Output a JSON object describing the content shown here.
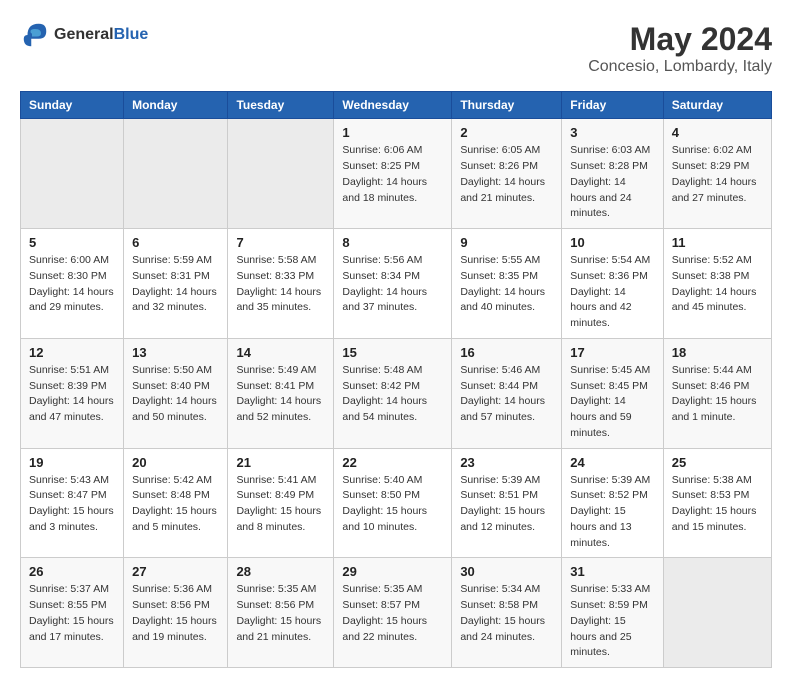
{
  "logo": {
    "line1": "General",
    "line2": "Blue"
  },
  "title": "May 2024",
  "subtitle": "Concesio, Lombardy, Italy",
  "header_days": [
    "Sunday",
    "Monday",
    "Tuesday",
    "Wednesday",
    "Thursday",
    "Friday",
    "Saturday"
  ],
  "weeks": [
    [
      {
        "day": "",
        "sunrise": "",
        "sunset": "",
        "daylight": ""
      },
      {
        "day": "",
        "sunrise": "",
        "sunset": "",
        "daylight": ""
      },
      {
        "day": "",
        "sunrise": "",
        "sunset": "",
        "daylight": ""
      },
      {
        "day": "1",
        "sunrise": "Sunrise: 6:06 AM",
        "sunset": "Sunset: 8:25 PM",
        "daylight": "Daylight: 14 hours and 18 minutes."
      },
      {
        "day": "2",
        "sunrise": "Sunrise: 6:05 AM",
        "sunset": "Sunset: 8:26 PM",
        "daylight": "Daylight: 14 hours and 21 minutes."
      },
      {
        "day": "3",
        "sunrise": "Sunrise: 6:03 AM",
        "sunset": "Sunset: 8:28 PM",
        "daylight": "Daylight: 14 hours and 24 minutes."
      },
      {
        "day": "4",
        "sunrise": "Sunrise: 6:02 AM",
        "sunset": "Sunset: 8:29 PM",
        "daylight": "Daylight: 14 hours and 27 minutes."
      }
    ],
    [
      {
        "day": "5",
        "sunrise": "Sunrise: 6:00 AM",
        "sunset": "Sunset: 8:30 PM",
        "daylight": "Daylight: 14 hours and 29 minutes."
      },
      {
        "day": "6",
        "sunrise": "Sunrise: 5:59 AM",
        "sunset": "Sunset: 8:31 PM",
        "daylight": "Daylight: 14 hours and 32 minutes."
      },
      {
        "day": "7",
        "sunrise": "Sunrise: 5:58 AM",
        "sunset": "Sunset: 8:33 PM",
        "daylight": "Daylight: 14 hours and 35 minutes."
      },
      {
        "day": "8",
        "sunrise": "Sunrise: 5:56 AM",
        "sunset": "Sunset: 8:34 PM",
        "daylight": "Daylight: 14 hours and 37 minutes."
      },
      {
        "day": "9",
        "sunrise": "Sunrise: 5:55 AM",
        "sunset": "Sunset: 8:35 PM",
        "daylight": "Daylight: 14 hours and 40 minutes."
      },
      {
        "day": "10",
        "sunrise": "Sunrise: 5:54 AM",
        "sunset": "Sunset: 8:36 PM",
        "daylight": "Daylight: 14 hours and 42 minutes."
      },
      {
        "day": "11",
        "sunrise": "Sunrise: 5:52 AM",
        "sunset": "Sunset: 8:38 PM",
        "daylight": "Daylight: 14 hours and 45 minutes."
      }
    ],
    [
      {
        "day": "12",
        "sunrise": "Sunrise: 5:51 AM",
        "sunset": "Sunset: 8:39 PM",
        "daylight": "Daylight: 14 hours and 47 minutes."
      },
      {
        "day": "13",
        "sunrise": "Sunrise: 5:50 AM",
        "sunset": "Sunset: 8:40 PM",
        "daylight": "Daylight: 14 hours and 50 minutes."
      },
      {
        "day": "14",
        "sunrise": "Sunrise: 5:49 AM",
        "sunset": "Sunset: 8:41 PM",
        "daylight": "Daylight: 14 hours and 52 minutes."
      },
      {
        "day": "15",
        "sunrise": "Sunrise: 5:48 AM",
        "sunset": "Sunset: 8:42 PM",
        "daylight": "Daylight: 14 hours and 54 minutes."
      },
      {
        "day": "16",
        "sunrise": "Sunrise: 5:46 AM",
        "sunset": "Sunset: 8:44 PM",
        "daylight": "Daylight: 14 hours and 57 minutes."
      },
      {
        "day": "17",
        "sunrise": "Sunrise: 5:45 AM",
        "sunset": "Sunset: 8:45 PM",
        "daylight": "Daylight: 14 hours and 59 minutes."
      },
      {
        "day": "18",
        "sunrise": "Sunrise: 5:44 AM",
        "sunset": "Sunset: 8:46 PM",
        "daylight": "Daylight: 15 hours and 1 minute."
      }
    ],
    [
      {
        "day": "19",
        "sunrise": "Sunrise: 5:43 AM",
        "sunset": "Sunset: 8:47 PM",
        "daylight": "Daylight: 15 hours and 3 minutes."
      },
      {
        "day": "20",
        "sunrise": "Sunrise: 5:42 AM",
        "sunset": "Sunset: 8:48 PM",
        "daylight": "Daylight: 15 hours and 5 minutes."
      },
      {
        "day": "21",
        "sunrise": "Sunrise: 5:41 AM",
        "sunset": "Sunset: 8:49 PM",
        "daylight": "Daylight: 15 hours and 8 minutes."
      },
      {
        "day": "22",
        "sunrise": "Sunrise: 5:40 AM",
        "sunset": "Sunset: 8:50 PM",
        "daylight": "Daylight: 15 hours and 10 minutes."
      },
      {
        "day": "23",
        "sunrise": "Sunrise: 5:39 AM",
        "sunset": "Sunset: 8:51 PM",
        "daylight": "Daylight: 15 hours and 12 minutes."
      },
      {
        "day": "24",
        "sunrise": "Sunrise: 5:39 AM",
        "sunset": "Sunset: 8:52 PM",
        "daylight": "Daylight: 15 hours and 13 minutes."
      },
      {
        "day": "25",
        "sunrise": "Sunrise: 5:38 AM",
        "sunset": "Sunset: 8:53 PM",
        "daylight": "Daylight: 15 hours and 15 minutes."
      }
    ],
    [
      {
        "day": "26",
        "sunrise": "Sunrise: 5:37 AM",
        "sunset": "Sunset: 8:55 PM",
        "daylight": "Daylight: 15 hours and 17 minutes."
      },
      {
        "day": "27",
        "sunrise": "Sunrise: 5:36 AM",
        "sunset": "Sunset: 8:56 PM",
        "daylight": "Daylight: 15 hours and 19 minutes."
      },
      {
        "day": "28",
        "sunrise": "Sunrise: 5:35 AM",
        "sunset": "Sunset: 8:56 PM",
        "daylight": "Daylight: 15 hours and 21 minutes."
      },
      {
        "day": "29",
        "sunrise": "Sunrise: 5:35 AM",
        "sunset": "Sunset: 8:57 PM",
        "daylight": "Daylight: 15 hours and 22 minutes."
      },
      {
        "day": "30",
        "sunrise": "Sunrise: 5:34 AM",
        "sunset": "Sunset: 8:58 PM",
        "daylight": "Daylight: 15 hours and 24 minutes."
      },
      {
        "day": "31",
        "sunrise": "Sunrise: 5:33 AM",
        "sunset": "Sunset: 8:59 PM",
        "daylight": "Daylight: 15 hours and 25 minutes."
      },
      {
        "day": "",
        "sunrise": "",
        "sunset": "",
        "daylight": ""
      }
    ]
  ]
}
